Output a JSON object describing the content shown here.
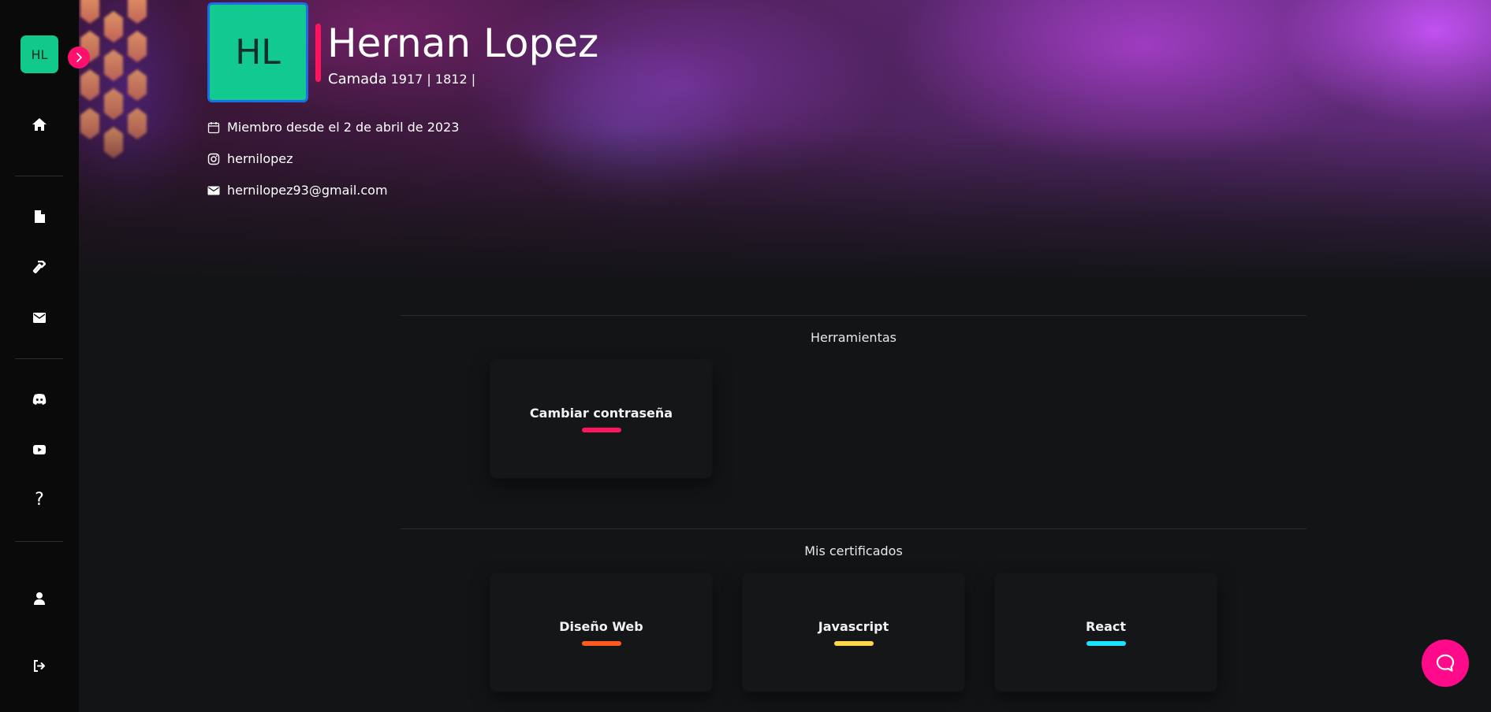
{
  "sidebar": {
    "avatar_initials": "HL",
    "icons": [
      "home-icon",
      "document-icon",
      "hammer-icon",
      "envelope-icon",
      "discord-icon",
      "youtube-icon",
      "question-icon",
      "user-icon",
      "logout-icon"
    ],
    "help_glyph": "?"
  },
  "profile": {
    "initials": "HL",
    "name": "Hernan Lopez",
    "camada_label": "Camada",
    "camada_values": "1917  |  1812  |",
    "member_since": "Miembro desde el 2 de abril de 2023",
    "instagram": "hernilopez",
    "email": "hernilopez93@gmail.com"
  },
  "sections": {
    "tools_title": "Herramientas",
    "certificates_title": "Mis certificados"
  },
  "tools": [
    {
      "label": "Cambiar contraseña",
      "color": "#ff155f"
    }
  ],
  "certificates": [
    {
      "label": "Diseño Web",
      "color": "#ff5a1f"
    },
    {
      "label": "Javascript",
      "color": "#ffd84a"
    },
    {
      "label": "React",
      "color": "#18e4ff"
    }
  ],
  "colors": {
    "accent": "#ff0f6e",
    "avatar": "#10c98b",
    "help_button": "#ff0a8a",
    "background": "#131416"
  }
}
